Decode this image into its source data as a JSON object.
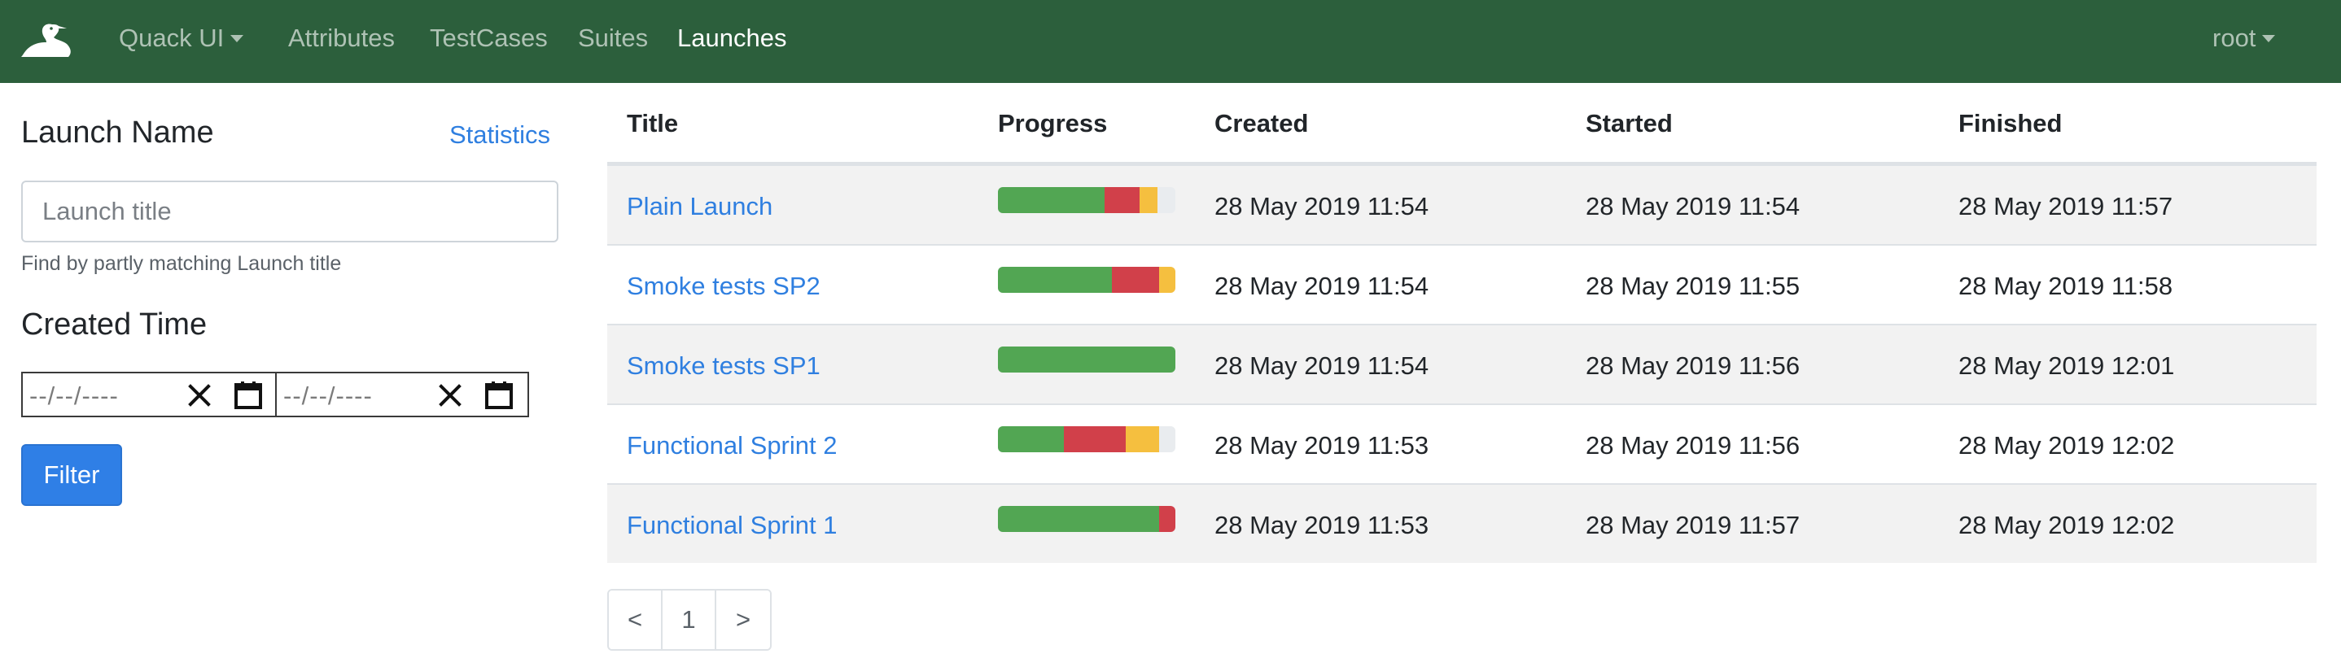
{
  "navbar": {
    "brand_menu": "Quack UI",
    "links": [
      "Attributes",
      "TestCases",
      "Suites",
      "Launches"
    ],
    "active": "Launches",
    "user": "root",
    "bg_color": "#2c5f3c"
  },
  "sidebar": {
    "launch_name_title": "Launch Name",
    "statistics_link": "Statistics",
    "launch_input_placeholder": "Launch title",
    "launch_input_value": "",
    "help_text": "Find by partly matching Launch title",
    "created_time_title": "Created Time",
    "date_from_placeholder": "--/--/----",
    "date_to_placeholder": "--/--/----",
    "filter_button": "Filter"
  },
  "table": {
    "headers": {
      "title": "Title",
      "progress": "Progress",
      "created": "Created",
      "started": "Started",
      "finished": "Finished"
    },
    "rows": [
      {
        "title": "Plain Launch",
        "progress": {
          "passed": 0.6,
          "failed": 0.2,
          "broken": 0.1,
          "remaining": 0.1
        },
        "created": "28 May 2019 11:54",
        "started": "28 May 2019 11:54",
        "finished": "28 May 2019 11:57"
      },
      {
        "title": "Smoke tests SP2",
        "progress": {
          "passed": 0.64,
          "failed": 0.27,
          "broken": 0.09,
          "remaining": 0.0
        },
        "created": "28 May 2019 11:54",
        "started": "28 May 2019 11:55",
        "finished": "28 May 2019 11:58"
      },
      {
        "title": "Smoke tests SP1",
        "progress": {
          "passed": 1.0,
          "failed": 0.0,
          "broken": 0.0,
          "remaining": 0.0
        },
        "created": "28 May 2019 11:54",
        "started": "28 May 2019 11:56",
        "finished": "28 May 2019 12:01"
      },
      {
        "title": "Functional Sprint 2",
        "progress": {
          "passed": 0.37,
          "failed": 0.35,
          "broken": 0.19,
          "remaining": 0.09
        },
        "created": "28 May 2019 11:53",
        "started": "28 May 2019 11:56",
        "finished": "28 May 2019 12:02"
      },
      {
        "title": "Functional Sprint 1",
        "progress": {
          "passed": 0.91,
          "failed": 0.09,
          "broken": 0.0,
          "remaining": 0.0
        },
        "created": "28 May 2019 11:53",
        "started": "28 May 2019 11:57",
        "finished": "28 May 2019 12:02"
      }
    ]
  },
  "pagination": {
    "prev": "<",
    "current": "1",
    "next": ">"
  },
  "colors": {
    "link": "#2f7fe0",
    "passed": "#52a653",
    "failed": "#d1404a",
    "broken": "#f5bf3f",
    "remaining": "#e9ecef"
  }
}
